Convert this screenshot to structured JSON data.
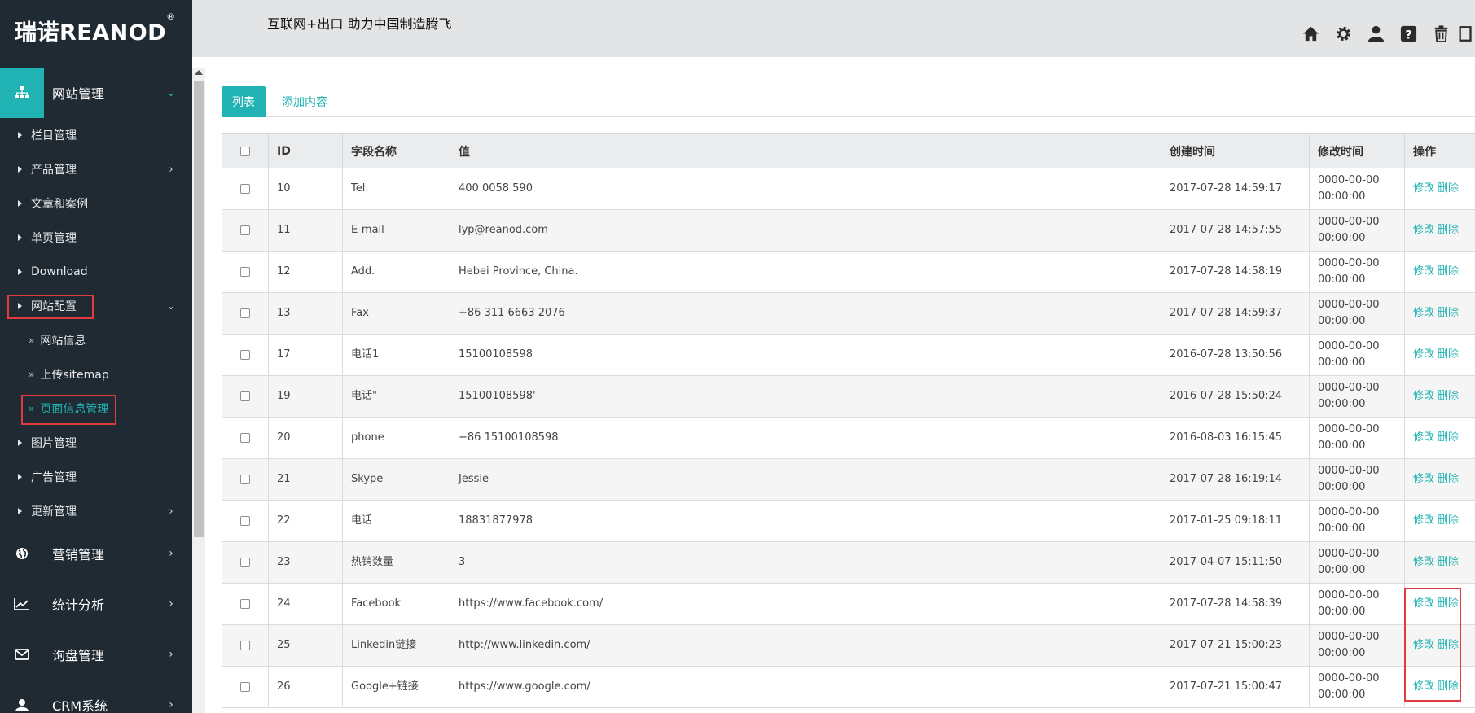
{
  "brand": {
    "logo_text": "瑞诺REANOD",
    "logo_mark": "®"
  },
  "header": {
    "slogan": "互联网+出口  助力中国制造腾飞",
    "icons": [
      "home-icon",
      "settings-icon",
      "user-icon",
      "help-icon",
      "trash-icon",
      "exit-icon"
    ]
  },
  "sidebar": {
    "section_site": {
      "label": "网站管理",
      "icon": "sitemap-icon"
    },
    "items": [
      {
        "label": "栏目管理"
      },
      {
        "label": "产品管理"
      },
      {
        "label": "文章和案例"
      },
      {
        "label": "单页管理"
      },
      {
        "label": "Download"
      },
      {
        "label": "网站配置"
      },
      {
        "label": "图片管理"
      },
      {
        "label": "广告管理"
      },
      {
        "label": "更新管理"
      }
    ],
    "config_children": [
      {
        "label": "网站信息"
      },
      {
        "label": "上传sitemap"
      },
      {
        "label": "页面信息管理"
      }
    ],
    "sections": [
      {
        "label": "营销管理",
        "icon": "globe-icon"
      },
      {
        "label": "统计分析",
        "icon": "chart-icon"
      },
      {
        "label": "询盘管理",
        "icon": "mail-icon"
      },
      {
        "label": "CRM系统",
        "icon": "crm-icon"
      }
    ]
  },
  "tabs": {
    "list": "列表",
    "add": "添加内容"
  },
  "table": {
    "headers": {
      "id": "ID",
      "field": "字段名称",
      "value": "值",
      "created": "创建时间",
      "modified": "修改时间",
      "ops": "操作"
    },
    "edit_label": "修改",
    "delete_label": "删除",
    "rows": [
      {
        "id": "10",
        "field": "Tel.",
        "value": "400 0058 590",
        "created": "2017-07-28 14:59:17",
        "modified": "0000-00-00\n00:00:00"
      },
      {
        "id": "11",
        "field": "E-mail",
        "value": "lyp@reanod.com",
        "created": "2017-07-28 14:57:55",
        "modified": "0000-00-00\n00:00:00"
      },
      {
        "id": "12",
        "field": "Add.",
        "value": "Hebei Province, China.",
        "created": "2017-07-28 14:58:19",
        "modified": "0000-00-00\n00:00:00"
      },
      {
        "id": "13",
        "field": "Fax",
        "value": "+86 311 6663 2076",
        "created": "2017-07-28 14:59:37",
        "modified": "0000-00-00\n00:00:00"
      },
      {
        "id": "17",
        "field": "电话1",
        "value": "15100108598",
        "created": "2016-07-28 13:50:56",
        "modified": "0000-00-00\n00:00:00"
      },
      {
        "id": "19",
        "field": "电话\"",
        "value": "15100108598'",
        "created": "2016-07-28 15:50:24",
        "modified": "0000-00-00\n00:00:00"
      },
      {
        "id": "20",
        "field": "phone",
        "value": "+86 15100108598",
        "created": "2016-08-03 16:15:45",
        "modified": "0000-00-00\n00:00:00"
      },
      {
        "id": "21",
        "field": "Skype",
        "value": "Jessie",
        "created": "2017-07-28 16:19:14",
        "modified": "0000-00-00\n00:00:00"
      },
      {
        "id": "22",
        "field": "电话",
        "value": "18831877978",
        "created": "2017-01-25 09:18:11",
        "modified": "0000-00-00\n00:00:00"
      },
      {
        "id": "23",
        "field": "热销数量",
        "value": "3",
        "created": "2017-04-07 15:11:50",
        "modified": "0000-00-00\n00:00:00"
      },
      {
        "id": "24",
        "field": "Facebook",
        "value": "https://www.facebook.com/",
        "created": "2017-07-28 14:58:39",
        "modified": "0000-00-00\n00:00:00"
      },
      {
        "id": "25",
        "field": "Linkedin链接",
        "value": "http://www.linkedin.com/",
        "created": "2017-07-21 15:00:23",
        "modified": "0000-00-00\n00:00:00"
      },
      {
        "id": "26",
        "field": "Google+链接",
        "value": "https://www.google.com/",
        "created": "2017-07-21 15:00:47",
        "modified": "0000-00-00\n00:00:00"
      }
    ]
  },
  "colors": {
    "accent": "#21b3b3",
    "sidebar": "#1f2a33",
    "highlight": "#e0393e"
  }
}
